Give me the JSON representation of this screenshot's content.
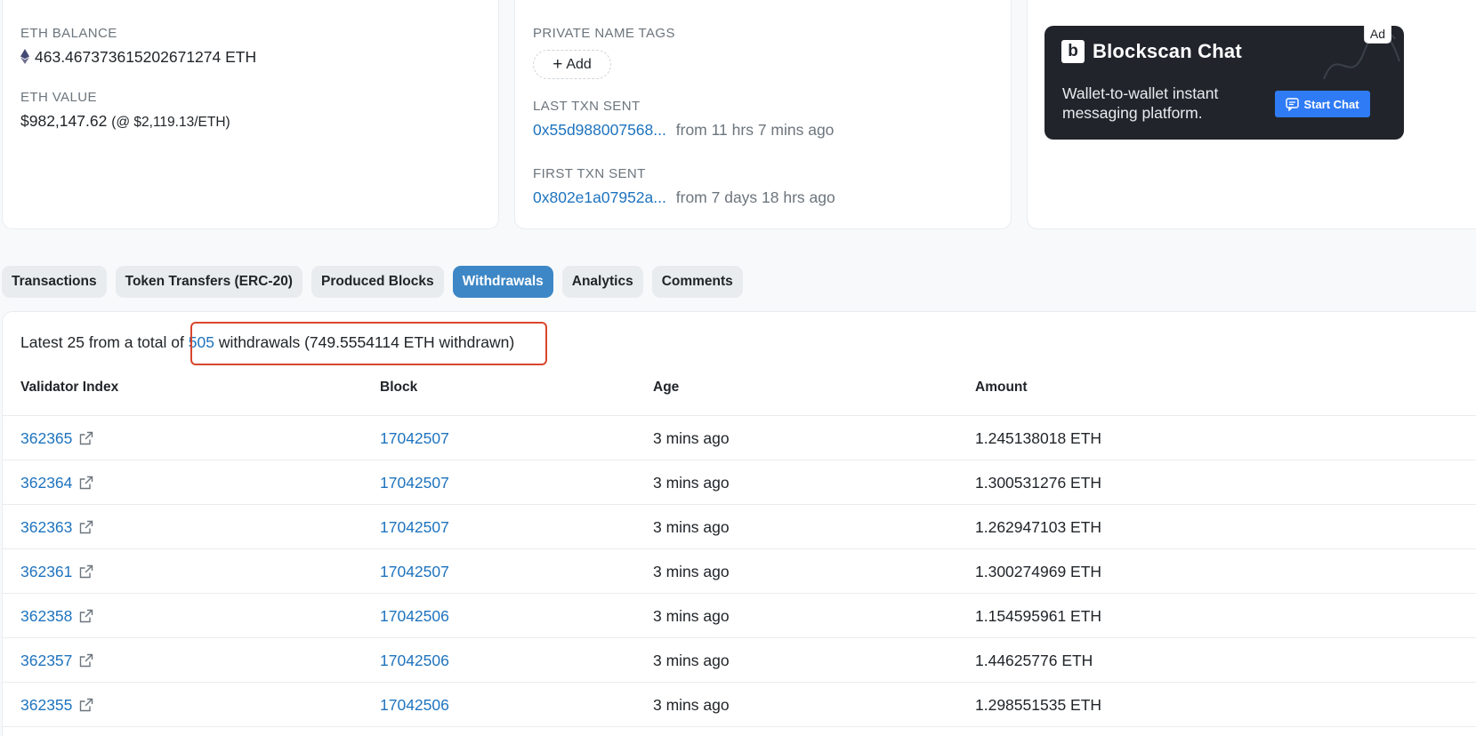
{
  "overview": {
    "balance_label": "ETH BALANCE",
    "balance_value": "463.467373615202671274 ETH",
    "value_label": "ETH VALUE",
    "value_amount": "$982,147.62",
    "value_rate": "(@ $2,119.13/ETH)"
  },
  "more_info": {
    "tags_label": "PRIVATE NAME TAGS",
    "add_label": "Add",
    "last_txn_label": "LAST TXN SENT",
    "last_txn_hash": "0x55d988007568...",
    "last_txn_time": "from 11 hrs 7 mins ago",
    "first_txn_label": "FIRST TXN SENT",
    "first_txn_hash": "0x802e1a07952a...",
    "first_txn_time": "from 7 days 18 hrs ago"
  },
  "ad": {
    "badge": "Ad",
    "logo_letter": "b",
    "title": "Blockscan Chat",
    "text": "Wallet-to-wallet instant messaging platform.",
    "cta": "Start Chat"
  },
  "tabs": [
    {
      "label": "Transactions",
      "active": false
    },
    {
      "label": "Token Transfers (ERC-20)",
      "active": false
    },
    {
      "label": "Produced Blocks",
      "active": false
    },
    {
      "label": "Withdrawals",
      "active": true
    },
    {
      "label": "Analytics",
      "active": false
    },
    {
      "label": "Comments",
      "active": false
    }
  ],
  "withdrawals": {
    "summary_prefix": "Latest 25 from a total of",
    "total_count": "505",
    "summary_suffix": "withdrawals (749.5554114 ETH withdrawn)",
    "columns": [
      "Validator Index",
      "Block",
      "Age",
      "Amount"
    ],
    "rows": [
      {
        "validator": "362365",
        "block": "17042507",
        "age": "3 mins ago",
        "amount": "1.245138018 ETH"
      },
      {
        "validator": "362364",
        "block": "17042507",
        "age": "3 mins ago",
        "amount": "1.300531276 ETH"
      },
      {
        "validator": "362363",
        "block": "17042507",
        "age": "3 mins ago",
        "amount": "1.262947103 ETH"
      },
      {
        "validator": "362361",
        "block": "17042507",
        "age": "3 mins ago",
        "amount": "1.300274969 ETH"
      },
      {
        "validator": "362358",
        "block": "17042506",
        "age": "3 mins ago",
        "amount": "1.154595961 ETH"
      },
      {
        "validator": "362357",
        "block": "17042506",
        "age": "3 mins ago",
        "amount": "1.44625776 ETH"
      },
      {
        "validator": "362355",
        "block": "17042506",
        "age": "3 mins ago",
        "amount": "1.298551535 ETH"
      }
    ]
  },
  "colors": {
    "link": "#1e73be",
    "active_tab": "#3d87c6",
    "highlight_box": "#d9462d",
    "ad_background": "#21252b",
    "ad_cta": "#2f7bf5"
  }
}
